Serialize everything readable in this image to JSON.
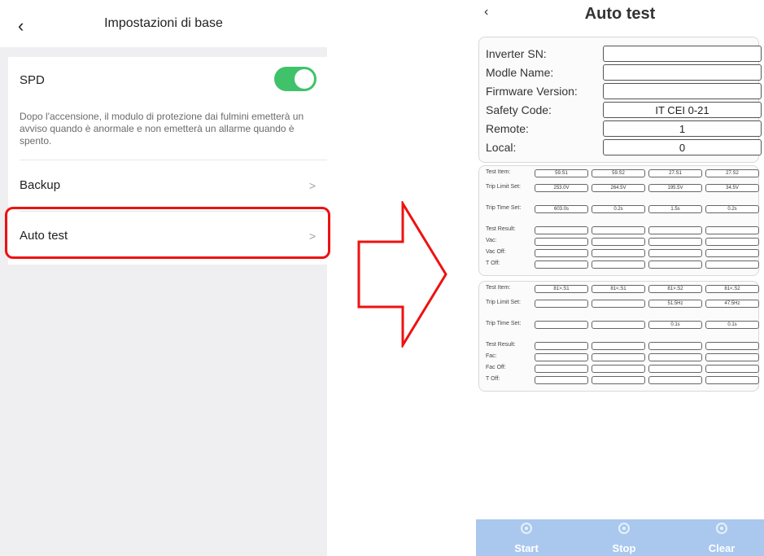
{
  "left_screen": {
    "title": "Impostazioni di base",
    "spd_label": "SPD",
    "spd_enabled": true,
    "spd_description": "Dopo l'accensione, il modulo di protezione dai fulmini emetterà un avviso quando è anormale e non emetterà un allarme quando è spento.",
    "backup_label": "Backup",
    "auto_test_label": "Auto test",
    "accent_color": "#3fc26a",
    "highlight_color": "#ee1111"
  },
  "arrow": {
    "color": "#ee1111",
    "icon": "right-arrow-outline-icon"
  },
  "right_screen": {
    "title": "Auto test",
    "info": [
      {
        "label": "Inverter SN:",
        "value": ""
      },
      {
        "label": "Modle Name:",
        "value": ""
      },
      {
        "label": "Firmware Version:",
        "value": ""
      },
      {
        "label": "Safety Code:",
        "value": "IT CEI 0-21"
      },
      {
        "label": "Remote:",
        "value": "1"
      },
      {
        "label": "Local:",
        "value": "0"
      }
    ],
    "voltage_table": {
      "rows": [
        {
          "label": "Test Item:",
          "values": [
            "59.S1",
            "59.S2",
            "27.S1",
            "27.S2"
          ]
        },
        {
          "label": "Trip Limit Set:",
          "values": [
            "253.0V",
            "264.5V",
            "195.5V",
            "34.5V"
          ]
        },
        {
          "label": "Trip Time Set:",
          "values": [
            "603.0s",
            "0.2s",
            "1.5s",
            "0.2s"
          ]
        },
        {
          "label": "Test Result:",
          "values": [
            "",
            "",
            "",
            ""
          ]
        },
        {
          "label": "Vac:",
          "values": [
            "",
            "",
            "",
            ""
          ]
        },
        {
          "label": "Vac Off:",
          "values": [
            "",
            "",
            "",
            ""
          ]
        },
        {
          "label": "T Off:",
          "values": [
            "",
            "",
            "",
            ""
          ]
        }
      ]
    },
    "frequency_table": {
      "rows": [
        {
          "label": "Test Item:",
          "values": [
            "81>.S1",
            "81<.S1",
            "81>.S2",
            "81<.S2"
          ]
        },
        {
          "label": "Trip Limit Set:",
          "values": [
            "",
            "",
            "51.5Hz",
            "47.5Hz"
          ]
        },
        {
          "label": "Trip Time Set:",
          "values": [
            "",
            "",
            "0.1s",
            "0.1s"
          ]
        },
        {
          "label": "Test Result:",
          "values": [
            "",
            "",
            "",
            ""
          ]
        },
        {
          "label": "Fac:",
          "values": [
            "",
            "",
            "",
            ""
          ]
        },
        {
          "label": "Fac Off:",
          "values": [
            "",
            "",
            "",
            ""
          ]
        },
        {
          "label": "T Off:",
          "values": [
            "",
            "",
            "",
            ""
          ]
        }
      ]
    },
    "buttons": [
      {
        "label": "Start",
        "icon": "play-icon"
      },
      {
        "label": "Stop",
        "icon": "stop-icon"
      },
      {
        "label": "Clear",
        "icon": "trash-icon"
      }
    ],
    "bottom_bar_color": "#aac8ee"
  }
}
